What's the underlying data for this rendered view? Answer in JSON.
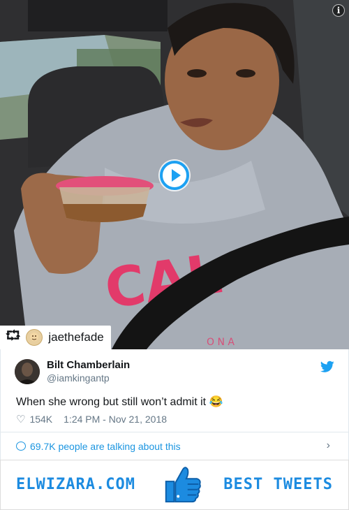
{
  "video": {
    "info_icon": "info-icon",
    "play_icon": "play-icon",
    "retweet": {
      "icon": "retweet-icon",
      "glyph": "⮔",
      "username": "jaethefade"
    }
  },
  "tweet": {
    "display_name": "Bilt Chamberlain",
    "handle": "@iamkingantp",
    "text": "When she wrong but still won’t admit it 😂",
    "likes": "154K",
    "timestamp": "1:24 PM - Nov 21, 2018",
    "talking": "69.7K people are talking about this",
    "chevron": "›"
  },
  "banner": {
    "left": "ELWIZARA.COM",
    "right": "BEST TWEETS"
  },
  "colors": {
    "accent": "#1da1f2",
    "link": "#1b95e0",
    "muted": "#657786",
    "banner": "#1c8be0"
  }
}
